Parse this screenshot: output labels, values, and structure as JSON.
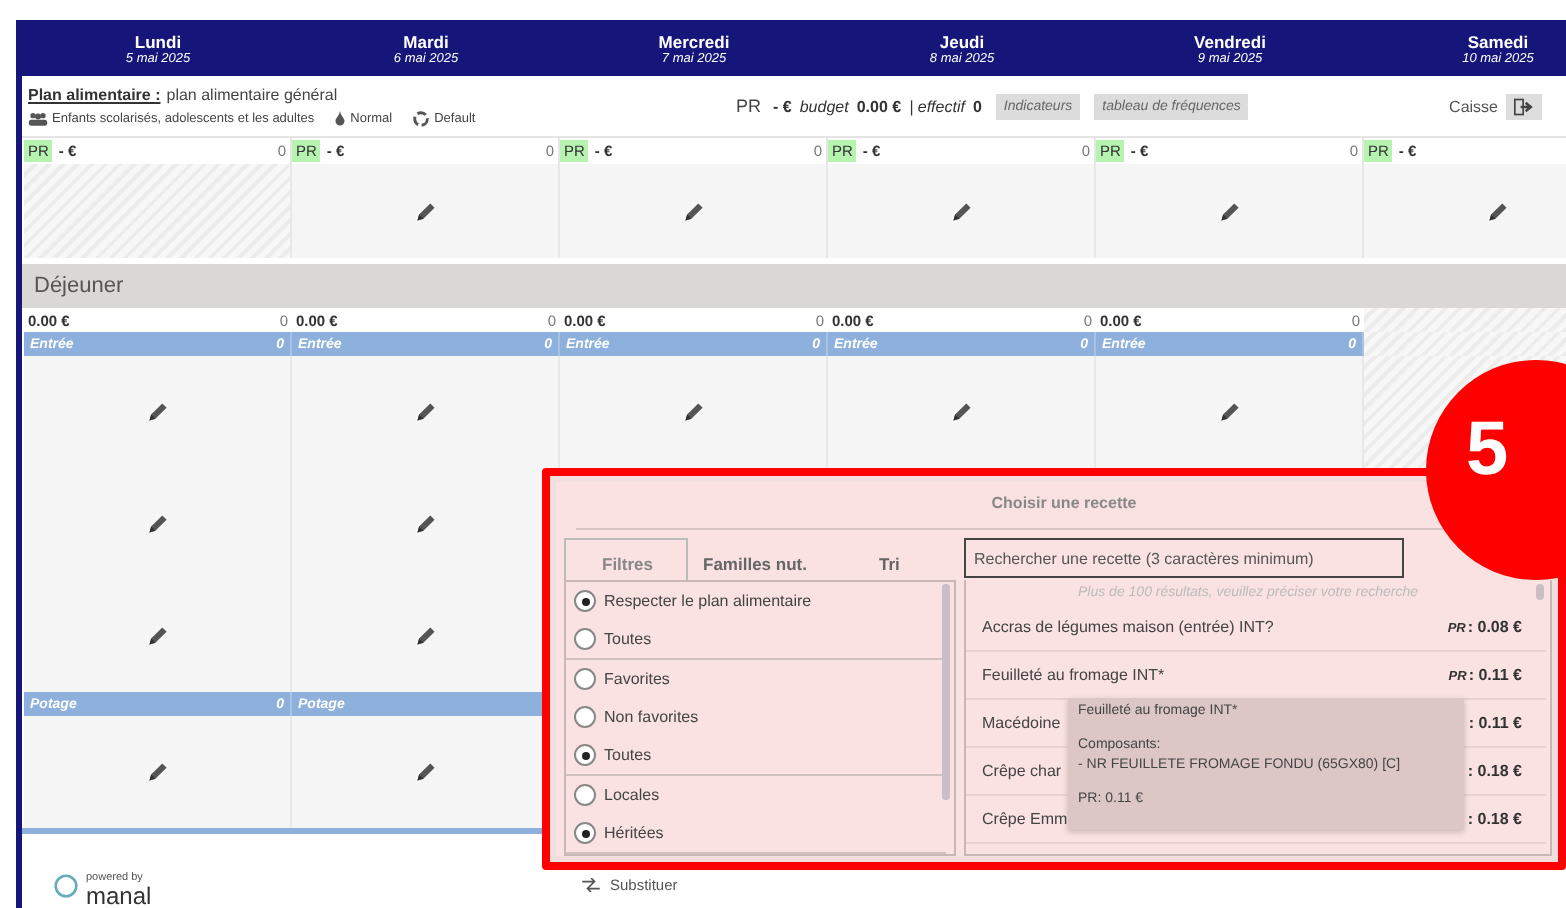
{
  "days": [
    {
      "name": "Lundi",
      "date": "5 mai 2025"
    },
    {
      "name": "Mardi",
      "date": "6 mai 2025"
    },
    {
      "name": "Mercredi",
      "date": "7 mai 2025"
    },
    {
      "name": "Jeudi",
      "date": "8 mai 2025"
    },
    {
      "name": "Vendredi",
      "date": "9 mai 2025"
    },
    {
      "name": "Samedi",
      "date": "10 mai 2025"
    }
  ],
  "plan": {
    "label": "Plan alimentaire :",
    "value": "plan alimentaire général",
    "audience": "Enfants scolarisés, adolescents et les adultes",
    "texture": "Normal",
    "regime": "Default"
  },
  "summary": {
    "pr_label": "PR",
    "pr_value": "- €",
    "budget_label": "budget",
    "budget_value": "0.00 €",
    "effectif_label": "| effectif",
    "effectif_value": "0",
    "buttons": [
      "Indicateurs",
      "tableau de fréquences"
    ],
    "caisse": "Caisse"
  },
  "day_totals": [
    {
      "pr": "PR",
      "value": "- €",
      "count": "0"
    },
    {
      "pr": "PR",
      "value": "- €",
      "count": "0"
    },
    {
      "pr": "PR",
      "value": "- €",
      "count": "0"
    },
    {
      "pr": "PR",
      "value": "- €",
      "count": "0"
    },
    {
      "pr": "PR",
      "value": "- €",
      "count": "0"
    },
    {
      "pr": "PR",
      "value": "- €"
    }
  ],
  "top_slots": [
    {
      "kind": "empty"
    },
    {
      "kind": "edit"
    },
    {
      "kind": "edit"
    },
    {
      "kind": "edit"
    },
    {
      "kind": "edit"
    },
    {
      "kind": "edit"
    }
  ],
  "meals": [
    {
      "title": "Déjeuner",
      "totals": [
        {
          "amount": "0.00 €",
          "count": "0"
        },
        {
          "amount": "0.00 €",
          "count": "0"
        },
        {
          "amount": "0.00 €",
          "count": "0"
        },
        {
          "amount": "0.00 €",
          "count": "0"
        },
        {
          "amount": "0.00 €",
          "count": "0"
        }
      ],
      "courses": [
        {
          "columns": [
            {
              "label": "Entrée",
              "count": "0"
            },
            {
              "label": "Entrée",
              "count": "0"
            },
            {
              "label": "Entrée",
              "count": "0"
            },
            {
              "label": "Entrée",
              "count": "0"
            },
            {
              "label": "Entrée",
              "count": "0"
            }
          ],
          "slots": [
            {
              "kind": "edit"
            },
            {
              "kind": "edit"
            },
            {
              "kind": "edit"
            }
          ]
        },
        {
          "columns": [
            {
              "label": "Potage",
              "count": "0"
            },
            {
              "label": "Potage"
            }
          ],
          "slots": [
            {
              "kind": "edit"
            }
          ]
        }
      ]
    }
  ],
  "footer": {
    "powered": "powered by",
    "brand": "manal"
  },
  "dialog": {
    "title": "Choisir une recette",
    "tabs": [
      {
        "label": "Filtres",
        "selected": true
      },
      {
        "label": "Familles nut.",
        "selected": false
      },
      {
        "label": "Tri",
        "selected": false
      }
    ],
    "filter_groups": [
      [
        {
          "label": "Respecter le plan alimentaire",
          "selected": true
        },
        {
          "label": "Toutes",
          "selected": false
        }
      ],
      [
        {
          "label": "Favorites",
          "selected": false
        },
        {
          "label": "Non favorites",
          "selected": false
        },
        {
          "label": "Toutes",
          "selected": true
        }
      ],
      [
        {
          "label": "Locales",
          "selected": false
        },
        {
          "label": "Héritées",
          "selected": true
        }
      ]
    ],
    "search": {
      "placeholder": "Rechercher une recette (3 caractères minimum)"
    },
    "notice": "Plus de 100 résultats, veuillez préciser votre recherche",
    "results": [
      {
        "name": "Accras de légumes maison (entrée) INT?",
        "pr": "PR",
        "price": ": 0.08 €"
      },
      {
        "name": "Feuilleté au fromage INT*",
        "pr": "PR",
        "price": ": 0.11 €"
      },
      {
        "name": "Macédoine",
        "price": ": 0.11 €"
      },
      {
        "name": "Crêpe char",
        "price": ": 0.18 €"
      },
      {
        "name": "Crêpe Emm",
        "price": ": 0.18 €"
      }
    ],
    "tooltip": {
      "title": "Feuilleté au fromage INT*",
      "heading": "Composants:",
      "item": "- NR FEUILLETE FROMAGE FONDU (65GX80) [C]",
      "price": "PR: 0.11 €"
    },
    "below": "Substituer"
  },
  "badge": "5"
}
